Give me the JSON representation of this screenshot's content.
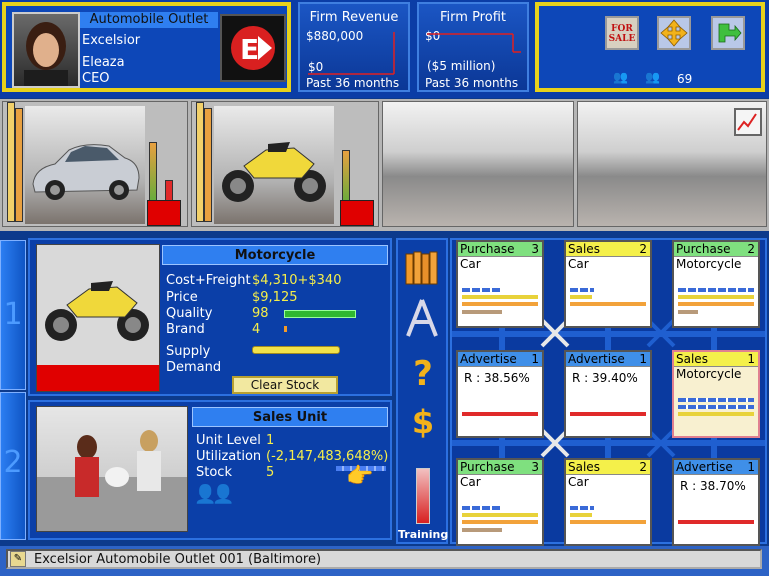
{
  "firm": {
    "type_label": "Automobile Outlet",
    "company": "Excelsior",
    "ceo_name": "Eleaza",
    "ceo_title": "CEO"
  },
  "revenue": {
    "title": "Firm Revenue",
    "max_label": "$880,000",
    "min_label": "$0",
    "period": "Past 36 months"
  },
  "profit": {
    "title": "Firm Profit",
    "top_label": "$0",
    "bottom_label": "($5 million)",
    "period": "Past 36 months"
  },
  "actions": {
    "sale_sign": "FOR SALE",
    "count": "69"
  },
  "product": {
    "title": "Motorcycle",
    "cost_label": "Cost+Freight",
    "cost_value": "$4,310+$340",
    "price_label": "Price",
    "price_value": "$9,125",
    "quality_label": "Quality",
    "quality_value": "98",
    "quality_fraction": 0.98,
    "brand_label": "Brand",
    "brand_value": "4",
    "supply_label": "Supply",
    "demand_label": "Demand",
    "clear_stock": "Clear Stock"
  },
  "sales_unit": {
    "title": "Sales Unit",
    "level_label": "Unit Level",
    "level_value": "1",
    "util_label": "Utilization",
    "util_value": "(-2,147,483,648%)",
    "stock_label": "Stock",
    "stock_value": "5"
  },
  "tools": {
    "training_label": "Training"
  },
  "side_tabs": [
    "1",
    "2"
  ],
  "grid": [
    {
      "title": "Purchase",
      "num": "3",
      "sub": "Car",
      "color": "#7fe07f"
    },
    {
      "title": "Sales",
      "num": "2",
      "sub": "Car",
      "color": "#f4f04a"
    },
    {
      "title": "Purchase",
      "num": "2",
      "sub": "Motorcycle",
      "color": "#7fe07f"
    },
    {
      "title": "Advertise",
      "num": "1",
      "sub": "R : 38.56%",
      "color": "#3f8fe8"
    },
    {
      "title": "Advertise",
      "num": "1",
      "sub": "R : 39.40%",
      "color": "#3f8fe8"
    },
    {
      "title": "Sales",
      "num": "1",
      "sub": "Motorcycle",
      "color": "#f4f04a"
    },
    {
      "title": "Purchase",
      "num": "3",
      "sub": "Car",
      "color": "#7fe07f"
    },
    {
      "title": "Sales",
      "num": "2",
      "sub": "Car",
      "color": "#f4f04a"
    },
    {
      "title": "Advertise",
      "num": "1",
      "sub": "R : 38.70%",
      "color": "#3f8fe8"
    }
  ],
  "status": {
    "text": "Excelsior Automobile Outlet 001 (Baltimore)"
  }
}
